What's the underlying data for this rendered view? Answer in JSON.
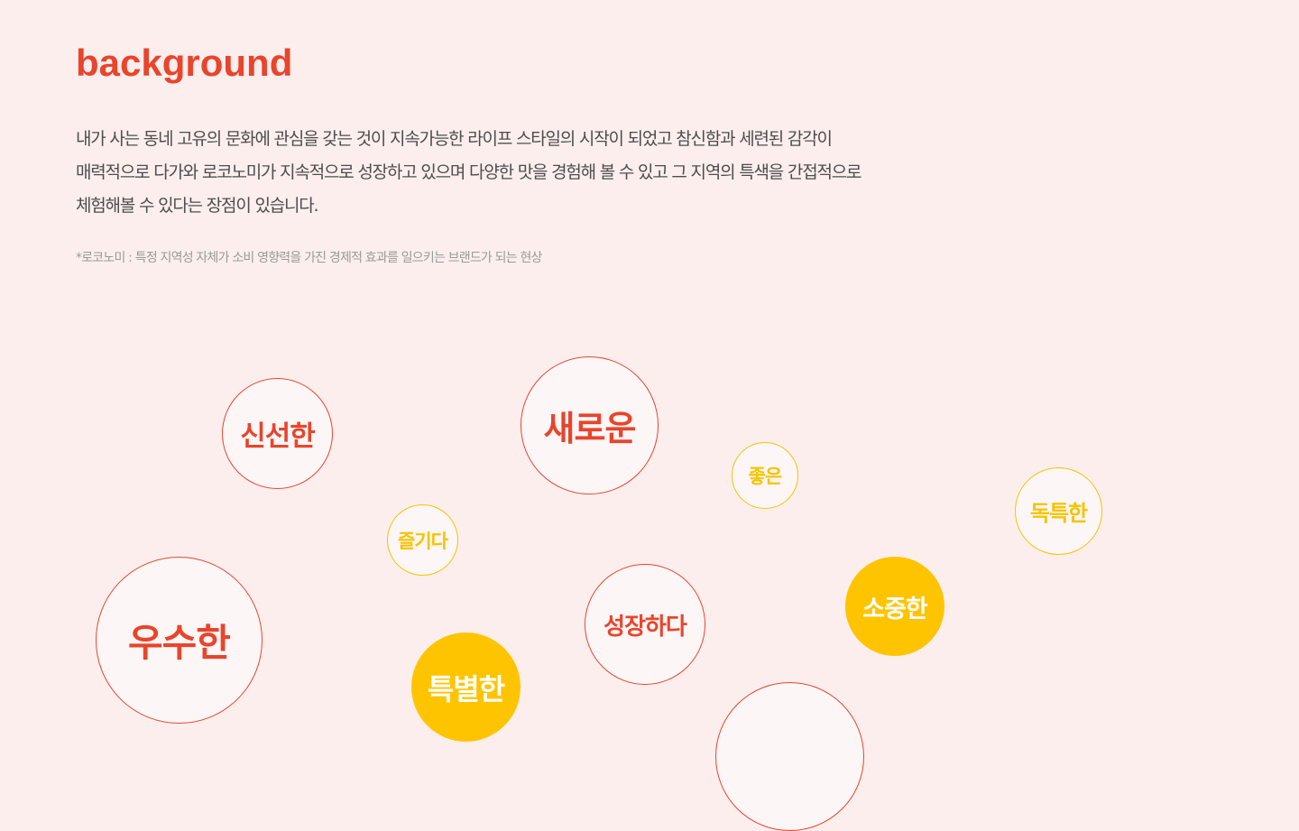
{
  "section": {
    "title": "background",
    "intro_lines": [
      "내가 사는 동네 고유의 문화에 관심을 갖는 것이 지속가능한 라이프 스타일의 시작이 되었고 참신함과 세련된 감각이",
      "매력적으로 다가와 로코노미가 지속적으로 성장하고 있으며 다양한 맛을 경험해 볼 수 있고 그 지역의 특색을 간접적으로",
      "체험해볼 수 있다는 장점이 있습니다."
    ],
    "footnote": "*로코노미 : 특정 지역성 자체가 소비 영향력을 가진 경제적 효과를 일으키는 브랜드가 되는 현상"
  },
  "keywords": [
    {
      "label": "신선한",
      "style": "red-outline"
    },
    {
      "label": "새로운",
      "style": "red-outline"
    },
    {
      "label": "좋은",
      "style": "yellow-outline"
    },
    {
      "label": "독특한",
      "style": "yellow-outline"
    },
    {
      "label": "즐기다",
      "style": "yellow-outline"
    },
    {
      "label": "우수한",
      "style": "red-outline"
    },
    {
      "label": "성장하다",
      "style": "red-outline"
    },
    {
      "label": "소중한",
      "style": "yellow-filled"
    },
    {
      "label": "특별한",
      "style": "yellow-filled"
    },
    {
      "label": "",
      "style": "red-outline"
    }
  ],
  "colors": {
    "background": "#fdeeee",
    "accent_red": "#e8452c",
    "accent_yellow": "#ffc400",
    "body_text": "#4d4d4d",
    "footnote_text": "#9a9a9a"
  }
}
